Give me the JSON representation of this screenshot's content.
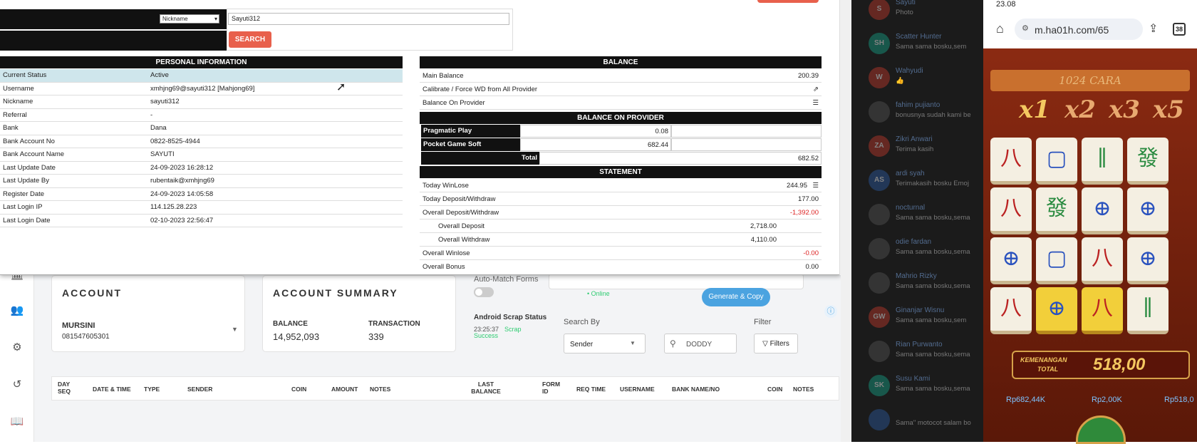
{
  "search": {
    "select_value": "Nickname",
    "input_value": "Sayuti312",
    "button_label": "SEARCH"
  },
  "personal": {
    "header": "PERSONAL INFORMATION",
    "rows": [
      {
        "k": "Current Status",
        "v": "Active"
      },
      {
        "k": "Username",
        "v": "xmhjng69@sayuti312  [Mahjong69]"
      },
      {
        "k": "Nickname",
        "v": "sayuti312"
      },
      {
        "k": "Referral",
        "v": "-"
      },
      {
        "k": "Bank",
        "v": "Dana"
      },
      {
        "k": "Bank Account No",
        "v": "0822-8525-4944"
      },
      {
        "k": "Bank Account Name",
        "v": "SAYUTI"
      },
      {
        "k": "Last Update Date",
        "v": "24-09-2023 16:28:12"
      },
      {
        "k": "Last Update By",
        "v": "rubentaik@xmhjng69"
      },
      {
        "k": "Register Date",
        "v": "24-09-2023 14:05:58"
      },
      {
        "k": "Last Login IP",
        "v": "114.125.28.223"
      },
      {
        "k": "Last Login Date",
        "v": "02-10-2023 22:56:47"
      }
    ]
  },
  "balance": {
    "header": "BALANCE",
    "main_label": "Main Balance",
    "main_value": "200.39",
    "calibrate_label": "Calibrate / Force WD from All Provider",
    "onprovider_label": "Balance On Provider",
    "provider_header": "BALANCE ON PROVIDER",
    "providers": [
      {
        "name": "Pragmatic Play",
        "value": "0.08"
      },
      {
        "name": "Pocket Game Soft",
        "value": "682.44"
      }
    ],
    "total_label": "Total",
    "total_value": "682.52"
  },
  "statement": {
    "header": "STATEMENT",
    "today_winlose_label": "Today WinLose",
    "today_winlose": "244.95",
    "today_dw_label": "Today Deposit/Withdraw",
    "today_dw": "177.00",
    "overall_dw_label": "Overall Deposit/Withdraw",
    "overall_dw": "-1,392.00",
    "overall_dep_label": "Overall Deposit",
    "overall_dep": "2,718.00",
    "overall_wd_label": "Overall Withdraw",
    "overall_wd": "4,110.00",
    "overall_winlose_label": "Overall Winlose",
    "overall_winlose": "-0.00",
    "overall_bonus_label": "Overall Bonus",
    "overall_bonus": "0.00"
  },
  "account": {
    "title": "ACCOUNT",
    "name": "MURSINI",
    "number": "081547605301"
  },
  "summary": {
    "title": "ACCOUNT SUMMARY",
    "balance_label": "BALANCE",
    "balance": "14,952,093",
    "transaction_label": "TRANSACTION",
    "transaction": "339"
  },
  "automatch": {
    "label": "Auto-Match Forms",
    "online": "• Online",
    "generate": "Generate & Copy"
  },
  "scrap": {
    "label": "Android Scrap Status",
    "time": "23:25:37",
    "status1": "Scrap",
    "status2": "Success"
  },
  "searchby": {
    "label": "Search By",
    "value": "Sender",
    "input": "DODDY",
    "filter_label": "Filter",
    "filter_button": "Filters"
  },
  "table_headers": [
    "DAY SEQ",
    "DATE & TIME",
    "TYPE",
    "SENDER",
    "COIN",
    "AMOUNT",
    "NOTES",
    "LAST BALANCE",
    "FORM ID",
    "REQ TIME",
    "USERNAME",
    "BANK NAME/NO",
    "COIN",
    "NOTES"
  ],
  "chats": [
    {
      "init": "S",
      "name": "Sayuti",
      "msg": "Photo",
      "color": "#c0392b"
    },
    {
      "init": "SH",
      "name": "Scatter Hunter",
      "msg": "Sama sama bosku,sem",
      "color": "#16a085"
    },
    {
      "init": "W",
      "name": "Wahyudi",
      "msg": "👍",
      "color": "#c0392b"
    },
    {
      "init": "",
      "name": "fahim pujianto",
      "msg": "bonusnya sudah kami be",
      "color": "#555"
    },
    {
      "init": "ZA",
      "name": "Zikri Anwari",
      "msg": "Terima kasih",
      "color": "#c0392b"
    },
    {
      "init": "AS",
      "name": "ardi syah",
      "msg": "Terimakasih bosku Emoj",
      "color": "#2c5aa0"
    },
    {
      "init": "",
      "name": "nocturnal",
      "msg": "Sama sama bosku,sema",
      "color": "#555"
    },
    {
      "init": "",
      "name": "odie fardan",
      "msg": "Sama sama bosku,sema",
      "color": "#555"
    },
    {
      "init": "",
      "name": "Mahrio Rizky",
      "msg": "Sama sama bosku,sema",
      "color": "#555"
    },
    {
      "init": "GW",
      "name": "Ginanjar Wisnu",
      "msg": "Sama sama bosku,sem",
      "color": "#c0392b"
    },
    {
      "init": "",
      "name": "Rian Purwanto",
      "msg": "Sama sama bosku,sema",
      "color": "#555"
    },
    {
      "init": "SK",
      "name": "Susu Kami",
      "msg": "Sama sama bosku,sema",
      "color": "#16a085"
    },
    {
      "init": "",
      "name": "",
      "msg": "Sama\" motocot salam bo",
      "color": "#2c5aa0"
    }
  ],
  "phone": {
    "time": "23.08",
    "url": "m.ha01h.com/65",
    "tabs": "38",
    "game_title": "1024 CARA",
    "mults": [
      "x1",
      "x2",
      "x3",
      "x5"
    ],
    "win_label1": "KEMENANGAN",
    "win_label2": "TOTAL",
    "win_value": "518,00",
    "bal1": "Rp682,44K",
    "bal2": "Rp2,00K",
    "bal3": "Rp518,0"
  },
  "colors": {
    "accent": "#e8604c",
    "blue": "#4ba3e0",
    "green": "#2ecc71"
  }
}
